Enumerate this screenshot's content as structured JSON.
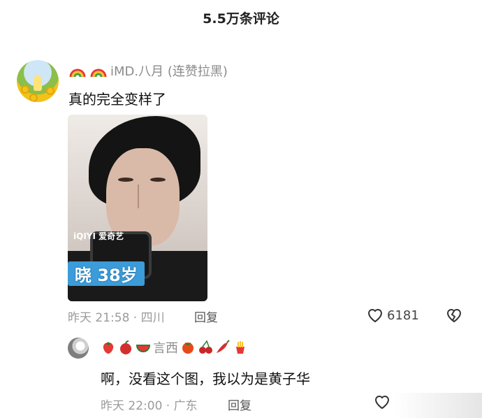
{
  "header": {
    "title": "5.5万条评论"
  },
  "comment": {
    "username": "iMD.八月 (连赞拉黑)",
    "badges": [
      "rainbow-icon",
      "rainbow-icon"
    ],
    "text": "真的完全变样了",
    "image_caption": "晓 38岁",
    "image_logo": "iQIYI 爱奇艺",
    "time": "昨天 21:58 · 四川",
    "reply_label": "回复",
    "like_count": "6181"
  },
  "reply": {
    "emoji_prefix": [
      "strawberry-icon",
      "apple-icon",
      "watermelon-icon"
    ],
    "username": "言西",
    "emoji_suffix": [
      "tomato-icon",
      "cherry-icon",
      "chili-icon",
      "fries-icon"
    ],
    "text": "啊，没看这个图，我以为是黄子华",
    "time": "昨天 22:00 · 广东",
    "reply_label": "回复"
  }
}
